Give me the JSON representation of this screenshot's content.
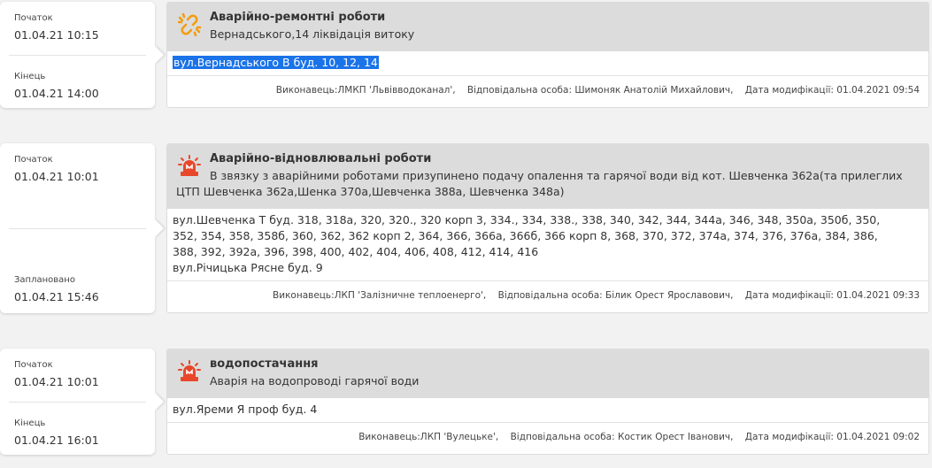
{
  "records": [
    {
      "start_label": "Початок",
      "start_value": "01.04.21 10:15",
      "end_label": "Кінець",
      "end_value": "01.04.21 14:00",
      "icon": "broken-link-icon",
      "title": "Аварійно-ремонтні роботи",
      "subtitle": "Вернадського,14 ліквідація витоку",
      "address_lines": [
        "вул.Вернадського В буд. 10,  12,  14"
      ],
      "executor": "Виконавець:ЛМКП 'Львівводоканал',",
      "responsible": "Відповідальна особа: Шимоняк Анатолій Михайлович,",
      "modified": "Дата модифікації: 01.04.2021 09:54"
    },
    {
      "start_label": "Початок",
      "start_value": "01.04.21 10:01",
      "end_label": "Заплановано",
      "end_value": "01.04.21 15:46",
      "icon": "siren-icon",
      "title": "Аварійно-відновлювальні роботи",
      "subtitle": "В звязку з аварійними роботами призупинено подачу опалення та гарячої води від кот. Шевченка 362а(та прилеглих ЦТП Шевченка 362а,Шенка 370а,Шевченка 388а, Шевченка 348а)",
      "address_lines": [
        "вул.Шевченка Т буд. 318,  318а,  320,  320.,  320 корп 3,  334.,  334,  338.,  338,  340,  342,  344,  344а,  346,  348,  350а,  350б,  350,",
        "352,  354,  358,  358б,  360,  362,  362 корп 2,  364,  366,  366а,  366б,  366 корп 8,  368,  370,  372,  374а,  374,  376,  376а,  384,  386,",
        "388,  392,  392а,  396,  398,  400,  402,  404,  406,  408,  412,  414,  416",
        "вул.Річицька Рясне буд. 9"
      ],
      "executor": "Виконавець:ЛКП 'Залізничне теплоенерго',",
      "responsible": "Відповідальна особа: Білик Орест Ярославович,",
      "modified": "Дата модифікації: 01.04.2021 09:33"
    },
    {
      "start_label": "Початок",
      "start_value": "01.04.21 10:01",
      "end_label": "Кінець",
      "end_value": "01.04.21 16:01",
      "icon": "siren-icon",
      "title": "водопостачання",
      "subtitle": "Аварія на водопроводі гарячої води",
      "address_lines": [
        "вул.Яреми Я проф буд. 4"
      ],
      "executor": "Виконавець:ЛКП 'Вулецьке',",
      "responsible": "Відповідальна особа: Костик Орест Іванович,",
      "modified": "Дата модифікації: 01.04.2021 09:02"
    }
  ],
  "colors": {
    "accent": "#f39c12",
    "siren_red": "#e8472a",
    "header_bg": "#dcdcdc",
    "highlight": "#1a73e8"
  }
}
